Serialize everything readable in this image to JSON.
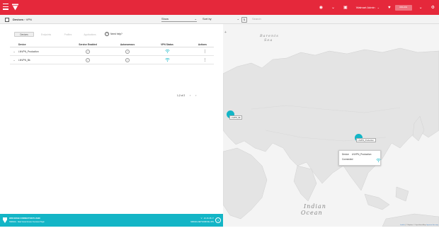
{
  "topbar": {
    "account_name": "Walmart Admin",
    "account_caret": "⌄",
    "org_box": "ORG-001",
    "icons": [
      "menu-icon",
      "brand-logo",
      "globe-icon",
      "chevron-down-icon",
      "monitor-icon",
      "heart-icon",
      "settings-icon"
    ]
  },
  "subbar": {
    "crumb_root": "Devices",
    "crumb_sep": "›",
    "crumb_page": "VPN",
    "show_label": "Show",
    "show_caret": "⌄",
    "sort_label": "Sort by",
    "sort_caret": "⌄",
    "sort_dir": "⇅",
    "search_placeholder": "Search"
  },
  "tabs": [
    "Devices",
    "Endpoints",
    "Profiles",
    "Applications"
  ],
  "help_label": "Need help?",
  "table": {
    "headers": {
      "device": "Device",
      "service": "Service Enabled",
      "autonomous": "Autonomous",
      "vpn": "VPN Status",
      "actions": "Actions"
    },
    "rows": [
      {
        "device": "LNVPN_Production",
        "service": "✓",
        "autonomous": "✓",
        "vpn": "wifi",
        "actions": "⋮"
      },
      {
        "device": "LNVPN_Bk",
        "service": "✓",
        "autonomous": "✓",
        "vpn": "wifi",
        "actions": "⋮"
      }
    ]
  },
  "pager": {
    "text": "1-2 of 2",
    "prev": "‹",
    "next": "›"
  },
  "footer": {
    "line1": "WAN EDGE CONNECTOR PLUGIN",
    "line2": "NWDIAG · Data Views Device Overview Plugin",
    "right1": "V  · 10.16.45.17",
    "right2": "NWDIAG-NETWORKING-VPN",
    "help": "?"
  },
  "map": {
    "zoom_label": "+",
    "barents_line1": "Barents",
    "barents_line2": "Sea",
    "indian_line1": "Indian",
    "indian_line2": "Ocean",
    "marker1_label": "LNVPN_Bk",
    "marker2_label": "LNVPN_Production",
    "popup": {
      "device_key": "Device",
      "device_val": "LNVPN_Production",
      "status": "Connected"
    },
    "attribution_leaflet": "Leaflet",
    "attribution_sep": " | © Mapbox © OpenStreetMap ",
    "attribution_improve": "Improve this map"
  },
  "colors": {
    "brand_red": "#e5283b",
    "teal": "#13b5c6"
  }
}
